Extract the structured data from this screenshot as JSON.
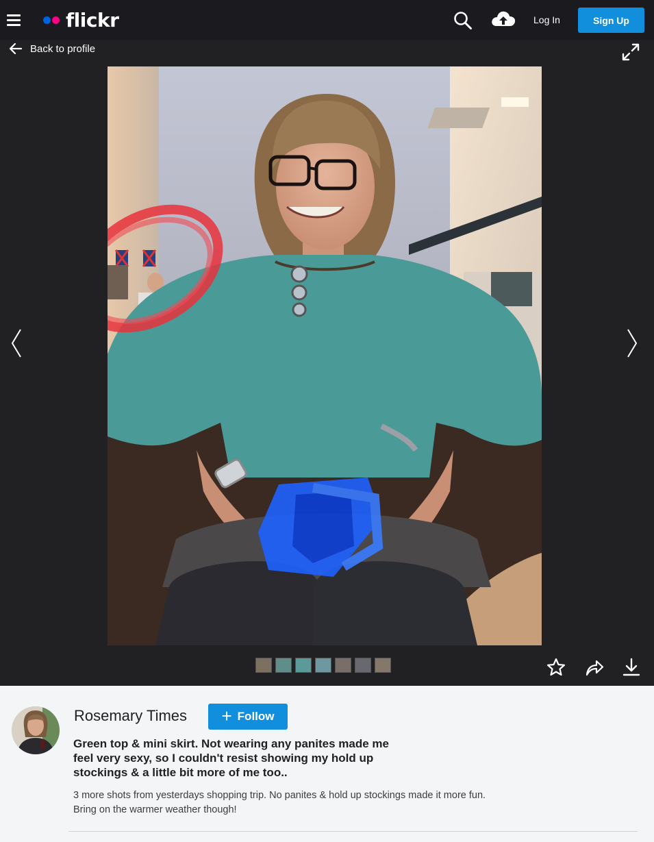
{
  "nav": {
    "logo_text": "flickr",
    "login_label": "Log In",
    "signup_label": "Sign Up",
    "accent": "#128fdc",
    "logo_blue": "#0063dc",
    "logo_pink": "#ff0084"
  },
  "stage": {
    "back_label": "Back to profile",
    "thumbnail_count": 7
  },
  "info": {
    "author": "Rosemary Times",
    "follow_label": "Follow",
    "title": "Green top & mini skirt. Not wearing any panites made me feel very sexy, so I couldn't resist showing my hold up stockings & a little bit more of me too..",
    "description_line1": "3 more shots from yesterdays shopping trip. No panites & hold up stockings made it more fun.",
    "description_line2": "Bring on the warmer weather though!"
  },
  "icons": {
    "menu": "hamburger-icon",
    "search": "search-icon",
    "upload": "cloud-upload-icon",
    "back": "arrow-left-icon",
    "expand": "expand-icon",
    "prev": "chevron-left-icon",
    "next": "chevron-right-icon",
    "fave": "star-icon",
    "share": "share-icon",
    "download": "download-icon"
  }
}
